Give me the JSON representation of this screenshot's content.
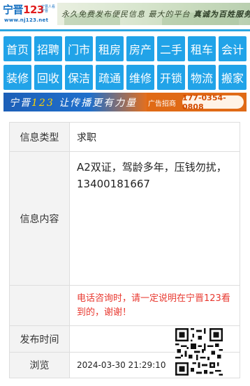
{
  "header": {
    "logo_cn": "宁晋",
    "logo_num": "123",
    "logo_tag": "宁晋人看宁晋",
    "logo_url": "www.nj123.net",
    "slogan_a": "永久免费发布便民信息",
    "slogan_b": "最大的平台",
    "slogan_c": "真诚为百姓服务"
  },
  "nav": {
    "row1": [
      "首页",
      "招聘",
      "门市",
      "租房",
      "房产",
      "二手",
      "租车",
      "会计"
    ],
    "row2": [
      "装修",
      "回收",
      "保洁",
      "疏通",
      "维修",
      "开锁",
      "物流",
      "搬家"
    ]
  },
  "ad": {
    "brand": "宁晋",
    "brand_num": "123",
    "slogan": "让传播更有力量",
    "label": "广告招商",
    "phone": "177-0354-0808"
  },
  "info": {
    "type_label": "信息类型",
    "type_value": "求职",
    "content_label": "信息内容",
    "content_value": "A2双证，驾龄多年，压钱勿扰，13400181667",
    "notice": "电话咨询时，请一定说明在宁晋123看到的，谢谢！",
    "time_label": "发布时间",
    "views_label": "浏览",
    "views_value": "2024-03-30 21:29:10"
  },
  "colors": {
    "nav_bg": "#21a3e8",
    "notice": "#e8382f",
    "ad_blue": "#1d5fb8",
    "ad_orange": "#e06a16"
  },
  "icons": {
    "qr": "qr-code-icon"
  }
}
